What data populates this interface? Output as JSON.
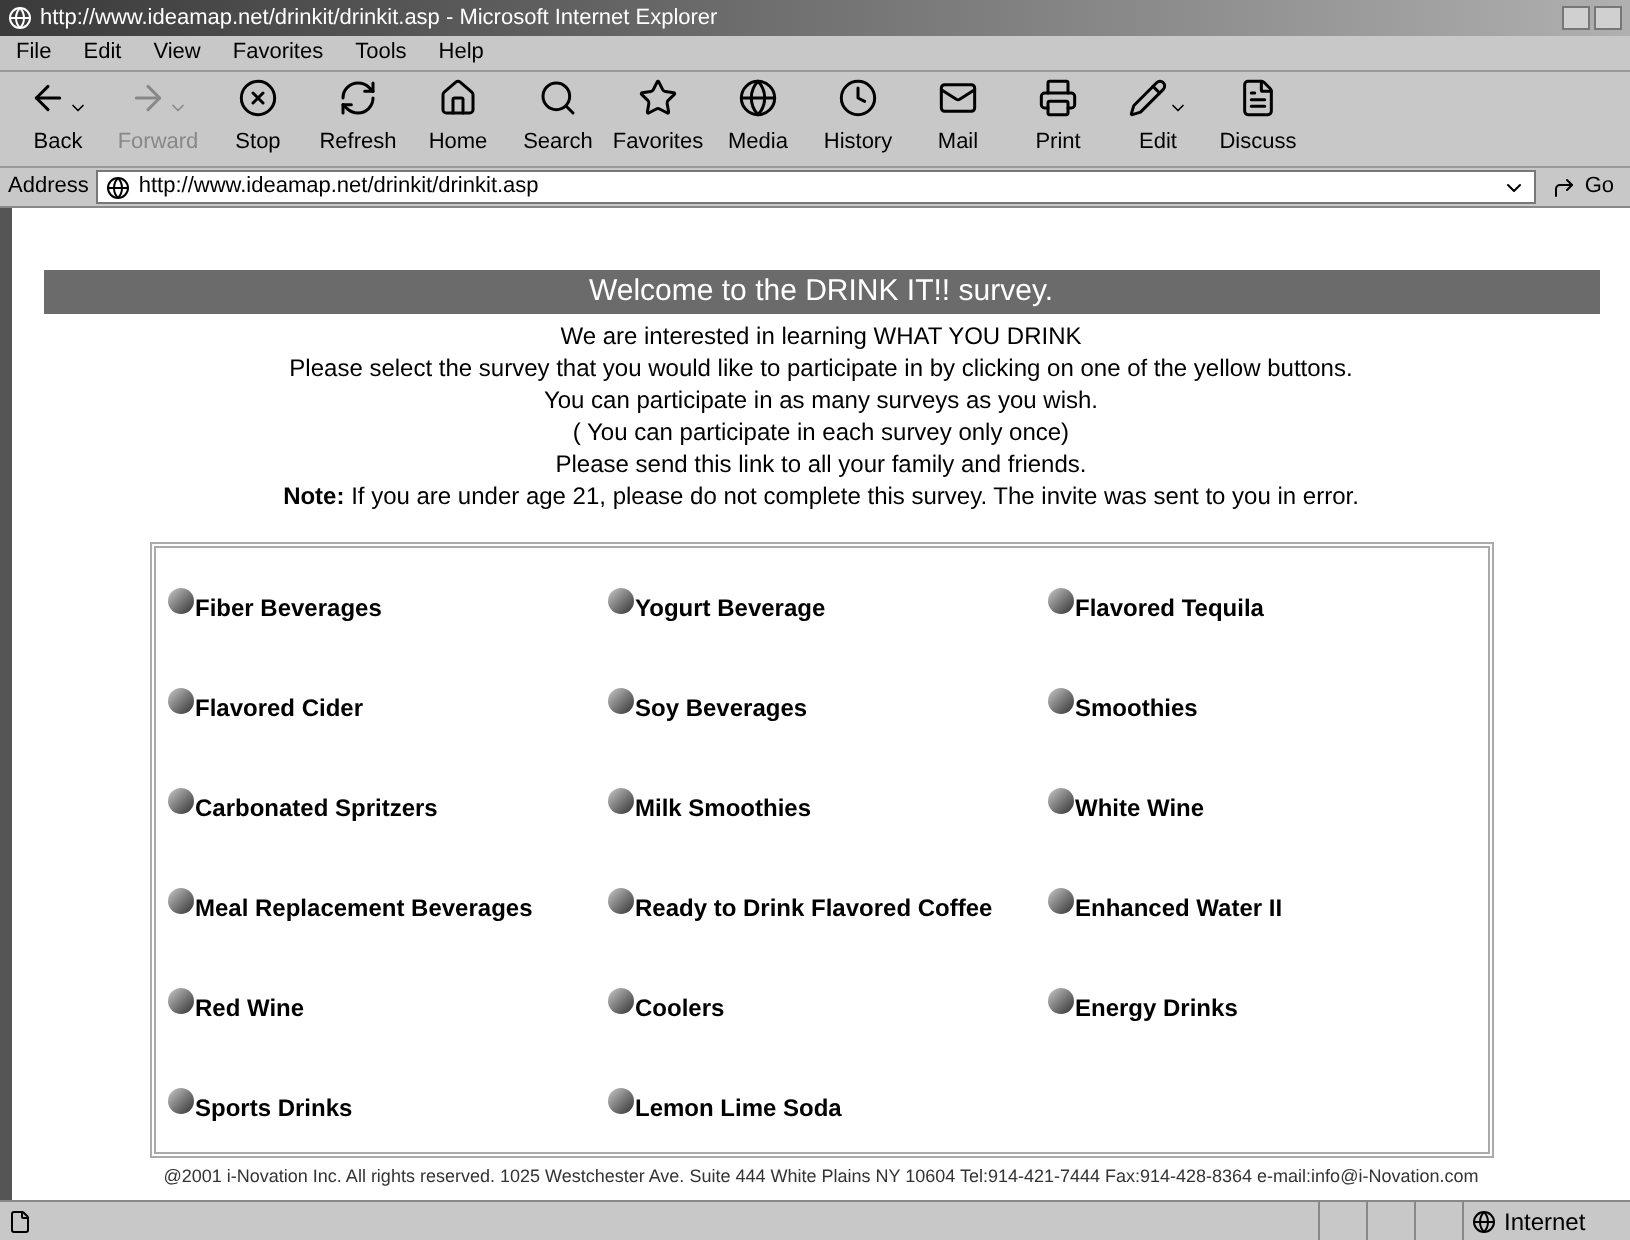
{
  "window": {
    "title": "http://www.ideamap.net/drinkit/drinkit.asp - Microsoft Internet Explorer"
  },
  "menu": [
    "File",
    "Edit",
    "View",
    "Favorites",
    "Tools",
    "Help"
  ],
  "toolbar": [
    {
      "label": "Back",
      "kind": "back",
      "disabled": false,
      "dropdown": true
    },
    {
      "label": "Forward",
      "kind": "forward",
      "disabled": true,
      "dropdown": true
    },
    {
      "label": "Stop",
      "kind": "stop",
      "disabled": false,
      "dropdown": false
    },
    {
      "label": "Refresh",
      "kind": "refresh",
      "disabled": false,
      "dropdown": false
    },
    {
      "label": "Home",
      "kind": "home",
      "disabled": false,
      "dropdown": false
    },
    {
      "label": "Search",
      "kind": "search",
      "disabled": false,
      "dropdown": false
    },
    {
      "label": "Favorites",
      "kind": "favorites",
      "disabled": false,
      "dropdown": false
    },
    {
      "label": "Media",
      "kind": "media",
      "disabled": false,
      "dropdown": false
    },
    {
      "label": "History",
      "kind": "history",
      "disabled": false,
      "dropdown": false
    },
    {
      "label": "Mail",
      "kind": "mail",
      "disabled": false,
      "dropdown": false
    },
    {
      "label": "Print",
      "kind": "print",
      "disabled": false,
      "dropdown": false
    },
    {
      "label": "Edit",
      "kind": "edit",
      "disabled": false,
      "dropdown": true
    },
    {
      "label": "Discuss",
      "kind": "discuss",
      "disabled": false,
      "dropdown": false
    }
  ],
  "address": {
    "label": "Address",
    "value": "http://www.ideamap.net/drinkit/drinkit.asp",
    "go": "Go"
  },
  "page": {
    "banner": "Welcome to the DRINK IT!! survey.",
    "intro": [
      "We are interested in learning WHAT YOU DRINK",
      "Please select the survey that you would like to participate in by clicking on one of the yellow buttons.",
      "You can participate in as many surveys as you wish.",
      "( You can participate in each survey only once)",
      "Please send this link to all your family and friends.",
      "**Note:** If you are under age 21, please do not complete this survey. The invite was sent to you in error."
    ],
    "surveys": [
      "Fiber Beverages",
      "Yogurt Beverage",
      "Flavored Tequila",
      "Flavored Cider",
      "Soy Beverages",
      "Smoothies",
      "Carbonated Spritzers",
      "Milk Smoothies",
      "White Wine",
      "Meal Replacement Beverages",
      "Ready to Drink Flavored Coffee",
      "Enhanced Water II",
      "Red Wine",
      "Coolers",
      "Energy Drinks",
      "Sports Drinks",
      "Lemon Lime Soda"
    ],
    "footer": "@2001 i-Novation Inc. All rights reserved. 1025 Westchester Ave. Suite 444 White Plains NY 10604 Tel:914-421-7444 Fax:914-428-8364 e-mail:info@i-Novation.com"
  },
  "status_bar": {
    "zone": "Internet"
  }
}
